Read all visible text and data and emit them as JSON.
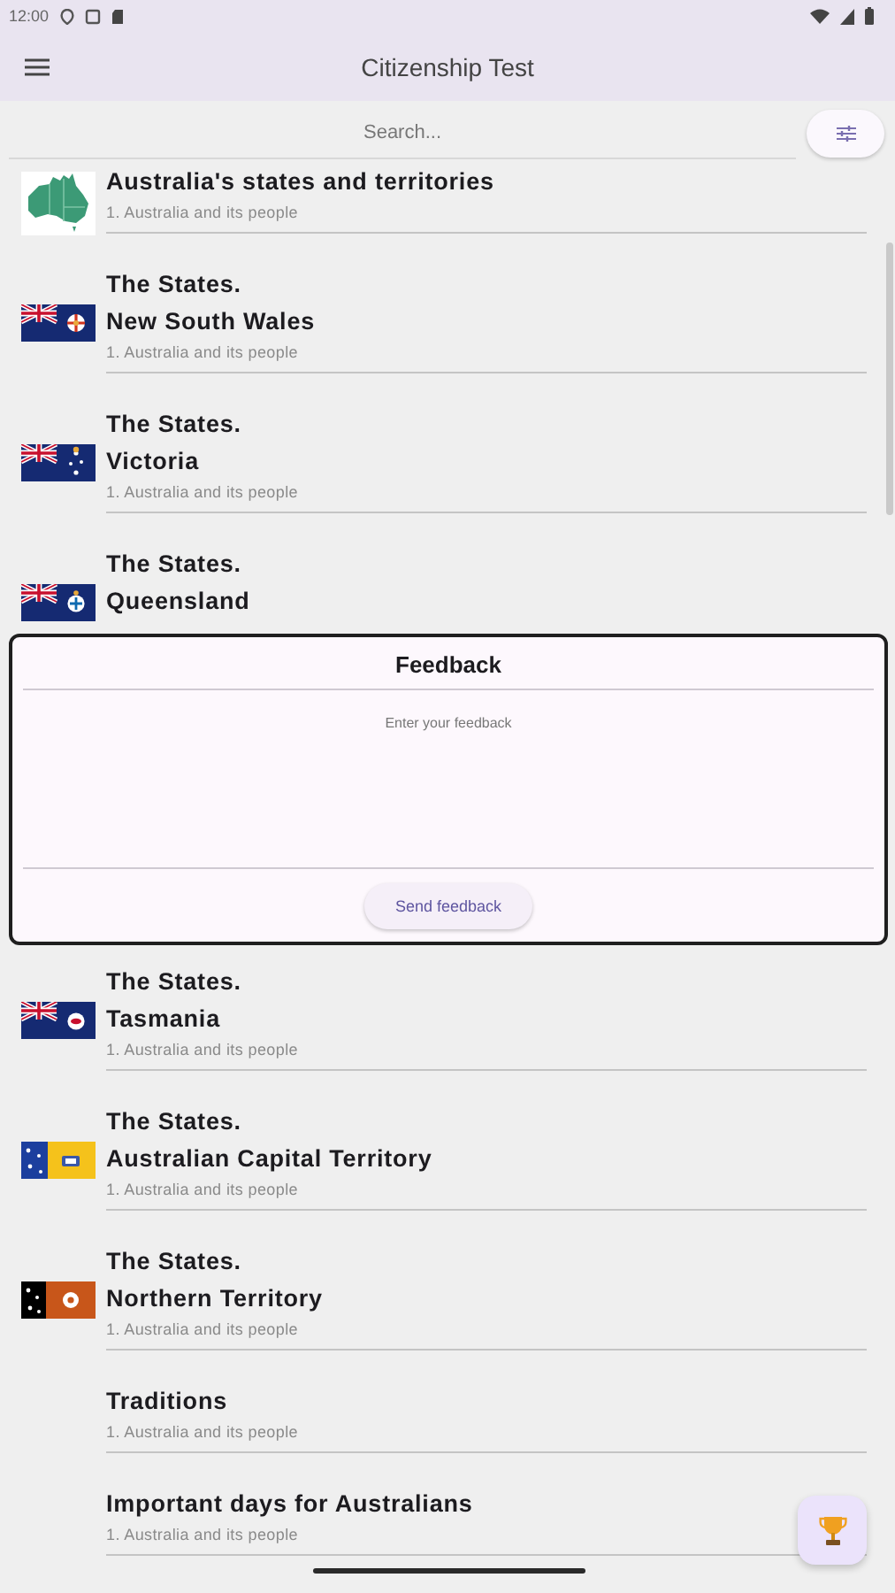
{
  "status_bar": {
    "time": "12:00"
  },
  "app_bar": {
    "title": "Citizenship Test"
  },
  "search": {
    "placeholder": "Search..."
  },
  "topics": [
    {
      "kind": "map",
      "title": "Australia's states and territories",
      "subtitle": "1. Australia and its people"
    },
    {
      "kind": "flag",
      "heading": "The States.",
      "title": "New South Wales",
      "subtitle": "1. Australia and its people"
    },
    {
      "kind": "flag",
      "heading": "The States.",
      "title": "Victoria",
      "subtitle": "1. Australia and its people"
    },
    {
      "kind": "flag",
      "heading": "The States.",
      "title": "Queensland"
    },
    {
      "kind": "flag",
      "heading": "The States.",
      "title": "Tasmania",
      "subtitle": "1. Australia and its people"
    },
    {
      "kind": "flag",
      "heading": "The States.",
      "title": "Australian Capital Territory",
      "subtitle": "1. Australia and its people"
    },
    {
      "kind": "flag",
      "heading": "The States.",
      "title": "Northern Territory",
      "subtitle": "1. Australia and its people"
    },
    {
      "kind": "plain",
      "title": "Traditions",
      "subtitle": "1. Australia and its people"
    },
    {
      "kind": "plain",
      "title": "Important days for Australians",
      "subtitle": "1. Australia and its people"
    }
  ],
  "feedback_dialog": {
    "title": "Feedback",
    "placeholder": "Enter your feedback",
    "button": "Send feedback"
  }
}
